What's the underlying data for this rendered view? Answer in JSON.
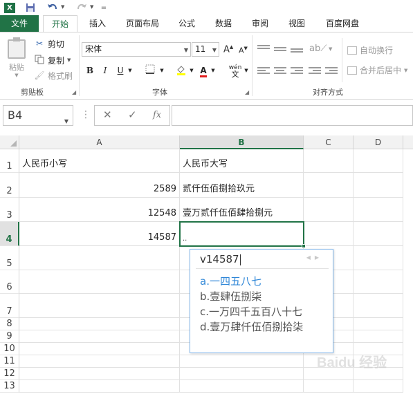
{
  "qat": {
    "app_icon": "excel-logo",
    "app_icon_text": "X",
    "more_glyph": "=",
    "save_icon": "save-icon",
    "undo_icon": "undo-icon",
    "redo_icon": "redo-icon"
  },
  "tabs": [
    "文件",
    "开始",
    "插入",
    "页面布局",
    "公式",
    "数据",
    "审阅",
    "视图",
    "百度网盘"
  ],
  "ribbon": {
    "clipboard": {
      "paste": "粘贴",
      "cut": "剪切",
      "copy": "复制",
      "format_painter": "格式刷",
      "label": "剪贴板"
    },
    "font": {
      "name": "宋体",
      "size": "11",
      "grow": "A",
      "shrink": "A",
      "bold": "B",
      "italic": "I",
      "underline": "U",
      "phonetic": "wén",
      "phonetic_sub": "文",
      "label": "字体"
    },
    "alignment": {
      "wrap_text": "自动换行",
      "merge_center": "合并后居中",
      "label": "对齐方式"
    }
  },
  "formula_bar": {
    "name_box": "B4",
    "fx": "fx",
    "cancel": "✕",
    "enter": "✓",
    "formula": ""
  },
  "columns": [
    "A",
    "B",
    "C",
    "D"
  ],
  "rows": [
    "1",
    "2",
    "3",
    "4",
    "5",
    "6",
    "7",
    "8",
    "9",
    "10",
    "11",
    "12",
    "13"
  ],
  "cells": {
    "A1": "人民币小写",
    "B1": "人民币大写",
    "A2": "2589",
    "B2": "贰仟伍佰捌拾玖元",
    "A3": "12548",
    "B3": "壹万贰仟伍佰肆拾捌元",
    "A4": "14587",
    "B4": ".."
  },
  "active_cell": "B4",
  "ime": {
    "composition": "v14587",
    "candidates": [
      "a.一四五八七",
      "b.壹肆伍捌柒",
      "c.一万四千五百八十七",
      "d.壹万肆仟伍佰捌拾柒"
    ],
    "highlighted": 0
  },
  "watermark": "Baidu 经验",
  "colors": {
    "accent": "#217346",
    "ime_highlight": "#2e86d7"
  }
}
